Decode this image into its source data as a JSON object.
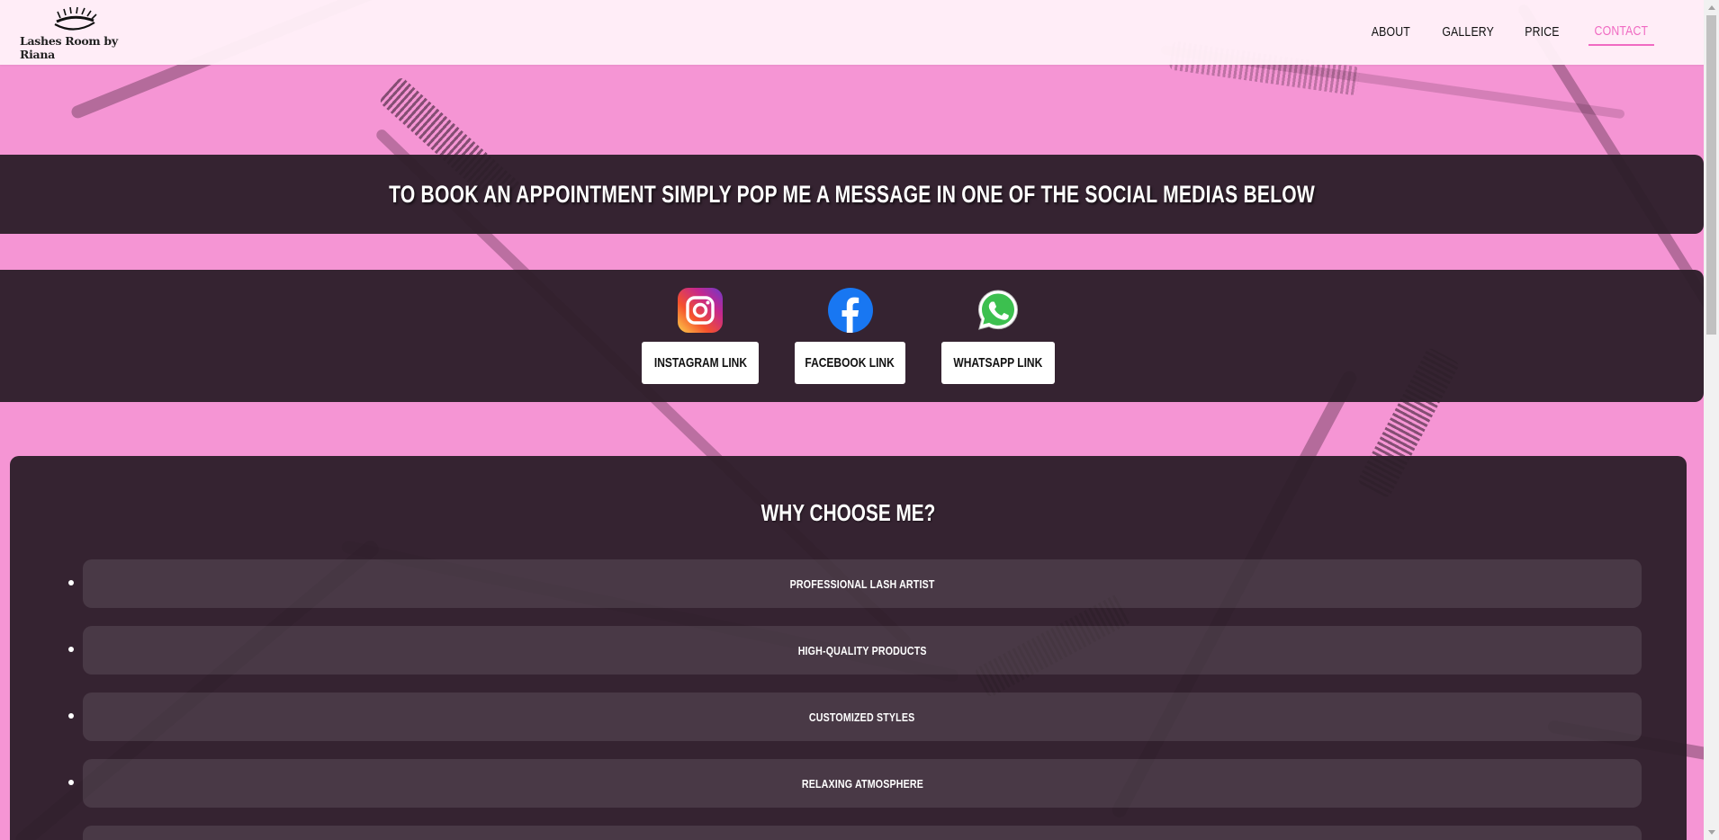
{
  "brand": {
    "name": "Lashes Room by Riana",
    "logo_icon": "eyelash-icon"
  },
  "nav": {
    "items": [
      {
        "label": "ABOUT",
        "active": false
      },
      {
        "label": "GALLERY",
        "active": false
      },
      {
        "label": "PRICE",
        "active": false
      },
      {
        "label": "CONTACT",
        "active": true
      }
    ],
    "active_color": "#f06ac2"
  },
  "banner": {
    "heading": "TO BOOK AN APPOINTMENT SIMPLY POP ME A MESSAGE IN ONE OF THE SOCIAL MEDIAS BELOW"
  },
  "social": {
    "links": [
      {
        "icon": "instagram-icon",
        "label": "INSTAGRAM LINK"
      },
      {
        "icon": "facebook-icon",
        "label": "FACEBOOK LINK"
      },
      {
        "icon": "whatsapp-icon",
        "label": "WHATSAPP LINK"
      }
    ]
  },
  "why": {
    "title": "WHY CHOOSE ME?",
    "items": [
      "PROFESSIONAL LASH ARTIST",
      "HIGH-QUALITY PRODUCTS",
      "CUSTOMIZED STYLES",
      "RELAXING ATMOSPHERE",
      ""
    ]
  },
  "colors": {
    "page_bg": "#f595d4",
    "panel_bg": "#2d1e2a",
    "header_bg": "#fff0f8"
  }
}
